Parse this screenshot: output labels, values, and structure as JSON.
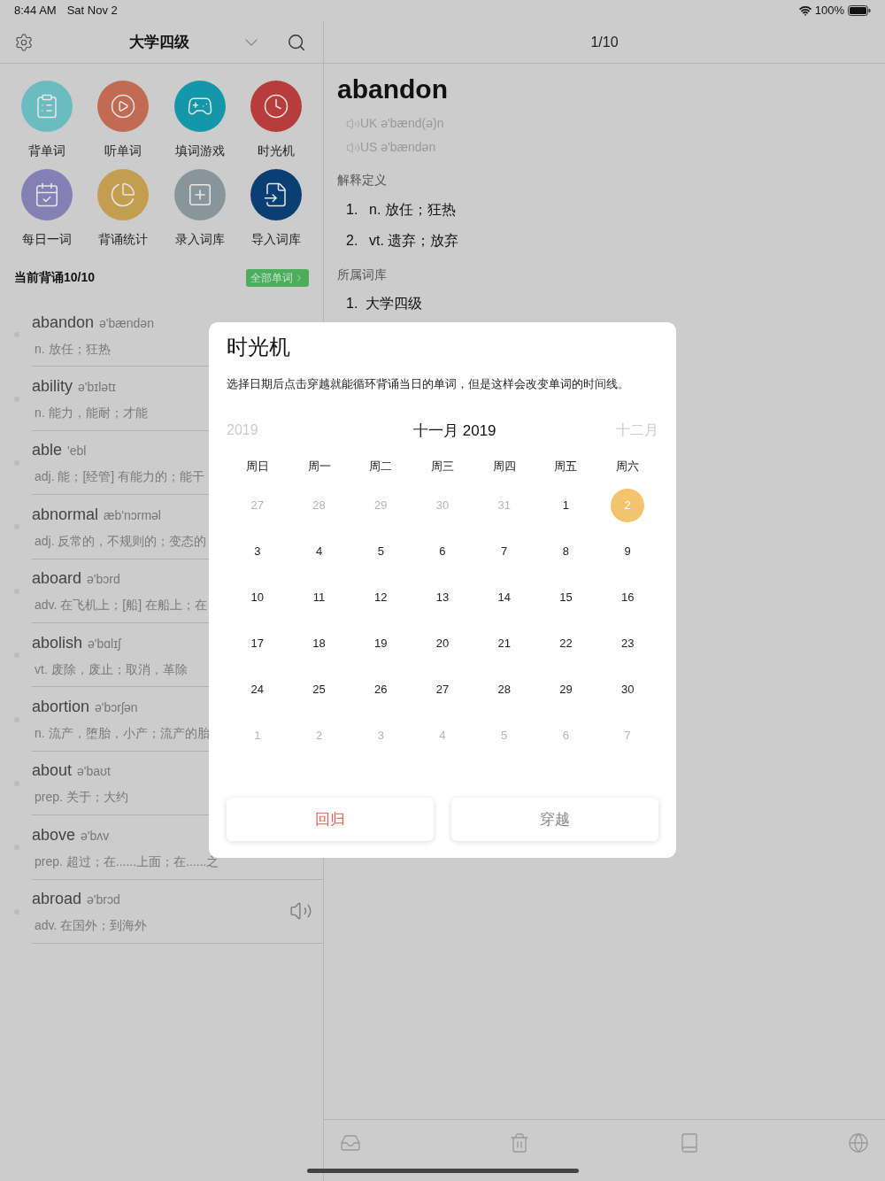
{
  "status_bar": {
    "time": "8:44 AM",
    "date": "Sat Nov 2",
    "battery": "100%"
  },
  "header": {
    "title": "大学四级",
    "counter": "1/10"
  },
  "shortcuts": [
    {
      "label": "背单词",
      "color": "#6bbcc0"
    },
    {
      "label": "听单词",
      "color": "#c06b52"
    },
    {
      "label": "填词游戏",
      "color": "#1497a8"
    },
    {
      "label": "时光机",
      "color": "#b73c3c"
    },
    {
      "label": "每日一词",
      "color": "#8480b5"
    },
    {
      "label": "背诵统计",
      "color": "#c39e4f"
    },
    {
      "label": "录入词库",
      "color": "#88969b"
    },
    {
      "label": "导入词库",
      "color": "#0b3f73"
    }
  ],
  "progress_label": "当前背诵10/10",
  "all_words_button": "全部单词",
  "words": [
    {
      "word": "abandon",
      "phonetic": "ə'bændən",
      "definition": "n. 放任；狂热"
    },
    {
      "word": "ability",
      "phonetic": "ə'bɪlətɪ",
      "definition": "n. 能力，能耐；才能"
    },
    {
      "word": "able",
      "phonetic": "'ebl",
      "definition": "adj. 能；[经管] 有能力的；能干"
    },
    {
      "word": "abnormal",
      "phonetic": "æb'nɔrməl",
      "definition": "adj. 反常的，不规则的；变态的"
    },
    {
      "word": "aboard",
      "phonetic": "ə'bɔrd",
      "definition": "adv. 在飞机上；[船] 在船上；在"
    },
    {
      "word": "abolish",
      "phonetic": "ə'bɑlɪʃ",
      "definition": "vt. 废除，废止；取消，革除"
    },
    {
      "word": "abortion",
      "phonetic": "ə'bɔrʃən",
      "definition": "n. 流产，堕胎，小产；流产的胎"
    },
    {
      "word": "about",
      "phonetic": "ə'baʊt",
      "definition": "prep. 关于；大约"
    },
    {
      "word": "above",
      "phonetic": "ə'bʌv",
      "definition": "prep. 超过；在......上面；在......之"
    },
    {
      "word": "abroad",
      "phonetic": "ə'brɔd",
      "definition": "adv. 在国外；到海外",
      "speaker": true
    }
  ],
  "detail": {
    "word": "abandon",
    "pronunciations": [
      "UK ə'bænd(ə)n",
      "US ə'bændən"
    ],
    "definitions_heading": "解释定义",
    "definitions": [
      {
        "number": "1.",
        "text": "n. 放任；狂热"
      },
      {
        "number": "2.",
        "text": "vt. 遗弃；放弃"
      }
    ],
    "wordbook_heading": "所属词库",
    "wordbooks": [
      {
        "number": "1.",
        "text": "大学四级"
      }
    ]
  },
  "modal": {
    "title": "时光机",
    "description": "选择日期后点击穿越就能循环背诵当日的单词，但是这样会改变单词的时间线。",
    "prev_label": "2019",
    "month_label": "十一月 2019",
    "next_label": "十二月",
    "weekdays": [
      "周日",
      "周一",
      "周二",
      "周三",
      "周四",
      "周五",
      "周六"
    ],
    "days": [
      {
        "label": "27",
        "outside": true,
        "selected": false
      },
      {
        "label": "28",
        "outside": true,
        "selected": false
      },
      {
        "label": "29",
        "outside": true,
        "selected": false
      },
      {
        "label": "30",
        "outside": true,
        "selected": false
      },
      {
        "label": "31",
        "outside": true,
        "selected": false
      },
      {
        "label": "1",
        "outside": false,
        "selected": false
      },
      {
        "label": "2",
        "outside": false,
        "selected": true
      },
      {
        "label": "3",
        "outside": false,
        "selected": false
      },
      {
        "label": "4",
        "outside": false,
        "selected": false
      },
      {
        "label": "5",
        "outside": false,
        "selected": false
      },
      {
        "label": "6",
        "outside": false,
        "selected": false
      },
      {
        "label": "7",
        "outside": false,
        "selected": false
      },
      {
        "label": "8",
        "outside": false,
        "selected": false
      },
      {
        "label": "9",
        "outside": false,
        "selected": false
      },
      {
        "label": "10",
        "outside": false,
        "selected": false
      },
      {
        "label": "11",
        "outside": false,
        "selected": false
      },
      {
        "label": "12",
        "outside": false,
        "selected": false
      },
      {
        "label": "13",
        "outside": false,
        "selected": false
      },
      {
        "label": "14",
        "outside": false,
        "selected": false
      },
      {
        "label": "15",
        "outside": false,
        "selected": false
      },
      {
        "label": "16",
        "outside": false,
        "selected": false
      },
      {
        "label": "17",
        "outside": false,
        "selected": false
      },
      {
        "label": "18",
        "outside": false,
        "selected": false
      },
      {
        "label": "19",
        "outside": false,
        "selected": false
      },
      {
        "label": "20",
        "outside": false,
        "selected": false
      },
      {
        "label": "21",
        "outside": false,
        "selected": false
      },
      {
        "label": "22",
        "outside": false,
        "selected": false
      },
      {
        "label": "23",
        "outside": false,
        "selected": false
      },
      {
        "label": "24",
        "outside": false,
        "selected": false
      },
      {
        "label": "25",
        "outside": false,
        "selected": false
      },
      {
        "label": "26",
        "outside": false,
        "selected": false
      },
      {
        "label": "27",
        "outside": false,
        "selected": false
      },
      {
        "label": "28",
        "outside": false,
        "selected": false
      },
      {
        "label": "29",
        "outside": false,
        "selected": false
      },
      {
        "label": "30",
        "outside": false,
        "selected": false
      },
      {
        "label": "1",
        "outside": true,
        "selected": false
      },
      {
        "label": "2",
        "outside": true,
        "selected": false
      },
      {
        "label": "3",
        "outside": true,
        "selected": false
      },
      {
        "label": "4",
        "outside": true,
        "selected": false
      },
      {
        "label": "5",
        "outside": true,
        "selected": false
      },
      {
        "label": "6",
        "outside": true,
        "selected": false
      },
      {
        "label": "7",
        "outside": true,
        "selected": false
      }
    ],
    "buttons": [
      {
        "label": "回归",
        "kind": "primary"
      },
      {
        "label": "穿越",
        "kind": "secondary"
      }
    ]
  }
}
